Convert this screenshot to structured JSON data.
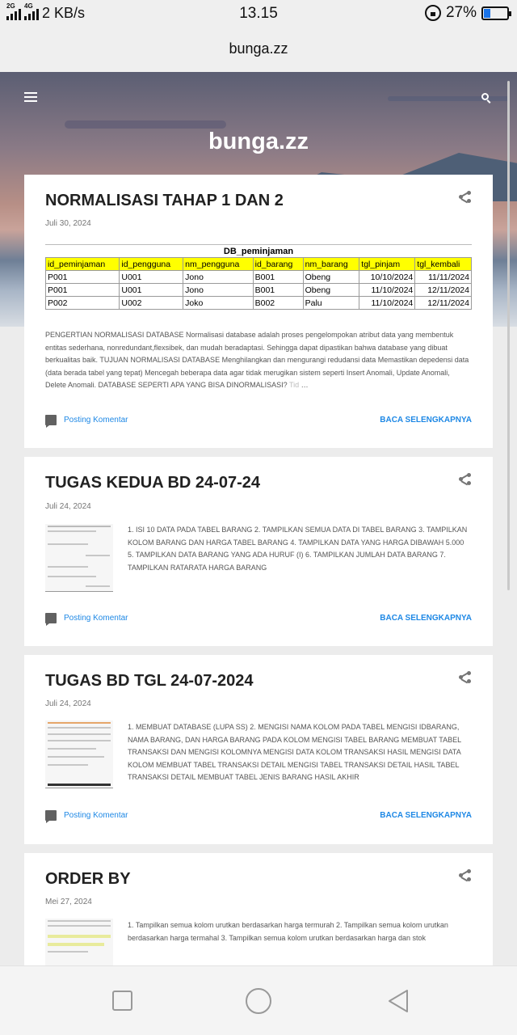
{
  "status_bar": {
    "network_1": "2G",
    "network_2": "4G",
    "speed": "2 KB/s",
    "time": "13.15",
    "battery": "27%",
    "battery_level": 0.27
  },
  "browser": {
    "url": "bunga.zz"
  },
  "header": {
    "blog_title": "bunga.zz",
    "menu_icon": "hamburger-icon",
    "search_icon": "search-icon"
  },
  "posts": [
    {
      "title": "NORMALISASI TAHAP 1 DAN 2",
      "date": "Juli 30, 2024",
      "snippet": "PENGERTIAN NORMALISASI DATABASE      Normalisasi database adalah proses pengelompokan atribut data yang membentuk entitas sederhana, nonredundant,flexsibek, dan mudah beradaptasi. Sehingga dapat dipastikan bahwa database yang dibuat berkualitas baik. TUJUAN NORMALISASI DATABASE Menghilangkan dan mengurangi redudansi data Memastikan depedensi data (data berada tabel yang tepat) Mencegah beberapa data agar tidak merugikan sistem seperti Insert Anomali, Update Anomali, Delete Anomali. DATABASE SEPERTI APA YANG BISA DINORMALISASI?",
      "snippet_tail": "Tid",
      "ellipsis": "…",
      "comment_label": "Posting Komentar",
      "read_more": "BACA SELENGKAPNYA",
      "sheet": {
        "caption": "DB_peminjaman",
        "headers": [
          "id_peminjaman",
          "id_pengguna",
          "nm_pengguna",
          "id_barang",
          "nm_barang",
          "tgl_pinjam",
          "tgl_kembali"
        ],
        "rows": [
          [
            "P001",
            "U001",
            "Jono",
            "B001",
            "Obeng",
            "10/10/2024",
            "11/11/2024"
          ],
          [
            "P001",
            "U001",
            "Jono",
            "B001",
            "Obeng",
            "11/10/2024",
            "12/11/2024"
          ],
          [
            "P002",
            "U002",
            "Joko",
            "B002",
            "Palu",
            "11/10/2024",
            "12/11/2024"
          ]
        ]
      }
    },
    {
      "title": "TUGAS KEDUA BD 24-07-24",
      "date": "Juli 24, 2024",
      "snippet": "1. ISI 10 DATA PADA TABEL BARANG 2. TAMPILKAN SEMUA DATA DI TABEL BARANG 3. TAMPILKAN KOLOM BARANG DAN HARGA TABEL BARANG 4. TAMPILKAN DATA YANG HARGA DIBAWAH 5.000 5. TAMPILKAN DATA BARANG YANG ADA HURUF (I) 6. TAMPILKAN JUMLAH DATA BARANG 7. TAMPILKAN RATARATA HARGA BARANG",
      "comment_label": "Posting Komentar",
      "read_more": "BACA SELENGKAPNYA"
    },
    {
      "title": "TUGAS BD TGL 24-07-2024",
      "date": "Juli 24, 2024",
      "snippet": "1. MEMBUAT DATABASE (LUPA SS) 2. MENGISI NAMA KOLOM PADA TABEL  MENGISI IDBARANG, NAMA BARANG, DAN HARGA BARANG PADA KOLOM  MENGISI TABEL BARANG MEMBUAT TABEL TRANSAKSI DAN MENGISI KOLOMNYA MENGISI DATA KOLOM TRANSAKSI  HASIL MENGISI DATA KOLOM  MEMBUAT TABEL TRANSAKSI DETAIL  MENGISI TABEL TRANSAKSI DETAIL HASIL TABEL TRANSAKSI DETAIL MEMBUAT TABEL JENIS BARANG HASIL AKHIR",
      "comment_label": "Posting Komentar",
      "read_more": "BACA SELENGKAPNYA"
    },
    {
      "title": "ORDER BY",
      "date": "Mei 27, 2024",
      "snippet": "1. Tampilkan semua kolom urutkan berdasarkan harga termurah  2. Tampilkan semua kolom urutkan berdasarkan harga termahal 3. Tampilkan semua kolom urutkan berdasarkan harga dan stok"
    }
  ],
  "nav_bar": {
    "recents_icon": "square-icon",
    "home_icon": "circle-icon",
    "back_icon": "triangle-back-icon"
  }
}
